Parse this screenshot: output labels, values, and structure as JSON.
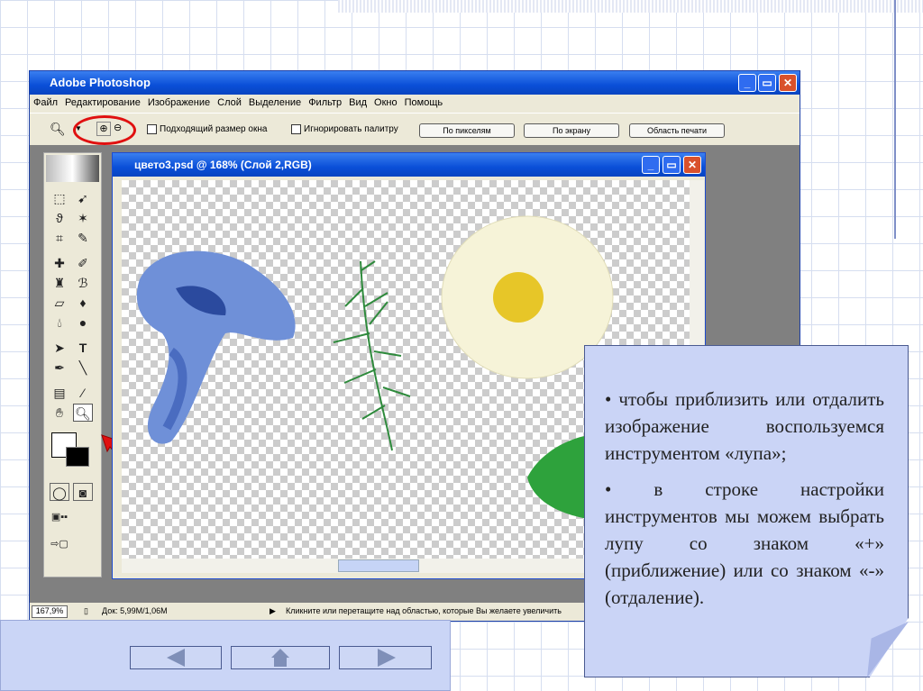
{
  "app": {
    "title": "Adobe Photoshop",
    "window_buttons": [
      "_",
      "▭",
      "✕"
    ]
  },
  "menu": [
    "Файл",
    "Редактирование",
    "Изображение",
    "Слой",
    "Выделение",
    "Фильтр",
    "Вид",
    "Окно",
    "Помощь"
  ],
  "options": {
    "fit_window": "Подходящий размер окна",
    "ignore_palettes": "Игнорировать палитру",
    "actual_pixels": "По пикселям",
    "fit_screen": "По экрану",
    "print_size": "Область печати"
  },
  "document": {
    "title": "цвето3.psd @ 168% (Слой 2,RGB)"
  },
  "status": {
    "zoom": "167,9%",
    "doc": "Док: 5,99M/1,06M",
    "hint": "Кликните или перетащите над областью, которые Вы желаете увеличить"
  },
  "note": {
    "bullets": [
      "• чтобы приблизить или отдалить изображение воспользуемся инструментом «лупа»;",
      "• в строке настройки инструментов мы можем выбрать лупу со знаком «+» (приближение) или со знаком «-» (отдаление)."
    ]
  },
  "colors": {
    "highlight": "#e01010",
    "note_bg": "#cad4f6",
    "titlebar": "#0a4fd8"
  }
}
